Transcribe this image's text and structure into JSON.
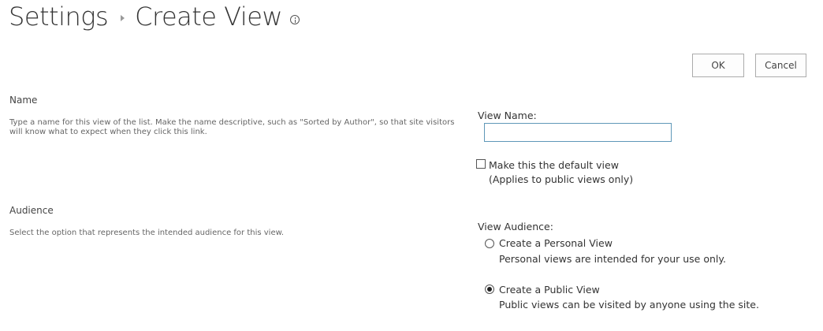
{
  "header": {
    "breadcrumb_root": "Settings",
    "page_title": "Create View",
    "info_icon": "info-icon"
  },
  "actions": {
    "ok_label": "OK",
    "cancel_label": "Cancel"
  },
  "name_section": {
    "title": "Name",
    "description": "Type a name for this view of the list. Make the name descriptive, such as \"Sorted by Author\", so that site visitors will know what to expect when they click this link.",
    "field_label": "View Name:",
    "field_value": "",
    "default_view_checked": false,
    "default_view_label": "Make this the default view",
    "default_view_note": "(Applies to public views only)"
  },
  "audience_section": {
    "title": "Audience",
    "description": "Select the option that represents the intended audience for this view.",
    "field_label": "View Audience:",
    "options": [
      {
        "label": "Create a Personal View",
        "description": "Personal views are intended for your use only.",
        "selected": false
      },
      {
        "label": "Create a Public View",
        "description": "Public views can be visited by anyone using the site.",
        "selected": true
      }
    ]
  }
}
